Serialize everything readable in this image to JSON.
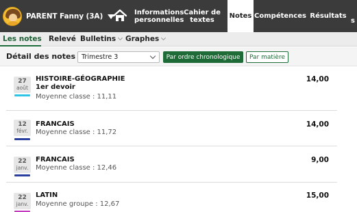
{
  "profile": {
    "name": "PARENT Fanny (3A)"
  },
  "nav": {
    "items": [
      {
        "label": "Informations personnelles"
      },
      {
        "label": "Cahier de textes"
      },
      {
        "label": "Notes"
      },
      {
        "label": "Compétences"
      },
      {
        "label": "Résultats"
      },
      {
        "label": "s"
      }
    ]
  },
  "subnav": {
    "items": [
      {
        "label": "Les notes"
      },
      {
        "label": "Relevé"
      },
      {
        "label": "Bulletins"
      },
      {
        "label": "Graphes"
      }
    ]
  },
  "filter": {
    "label": "Détail des notes",
    "period": "Trimestre 3",
    "chrono_label": "Par ordre chronologique",
    "matiere_label": "Par matière"
  },
  "grades": [
    {
      "day": "27",
      "month": "août",
      "subject": "HISTOIRE-GÉOGRAPHIE",
      "devoir": "1er devoir",
      "average": "Moyenne classe : 11,11",
      "value": "14,00",
      "color": "#2ec4e6"
    },
    {
      "day": "12",
      "month": "févr.",
      "subject": "FRANCAIS",
      "devoir": "",
      "average": "Moyenne classe : 11,72",
      "value": "14,00",
      "color": "#2b3f9e"
    },
    {
      "day": "22",
      "month": "janv.",
      "subject": "FRANCAIS",
      "devoir": "",
      "average": "Moyenne classe : 12,46",
      "value": "9,00",
      "color": "#2b3f9e"
    },
    {
      "day": "22",
      "month": "janv.",
      "subject": "LATIN",
      "devoir": "",
      "average": "Moyenne groupe : 12,67",
      "value": "15,00",
      "color": "#c23bbf"
    }
  ],
  "colors": {
    "topbar": "#3b3b3b",
    "accent_green": "#1e6b37"
  }
}
